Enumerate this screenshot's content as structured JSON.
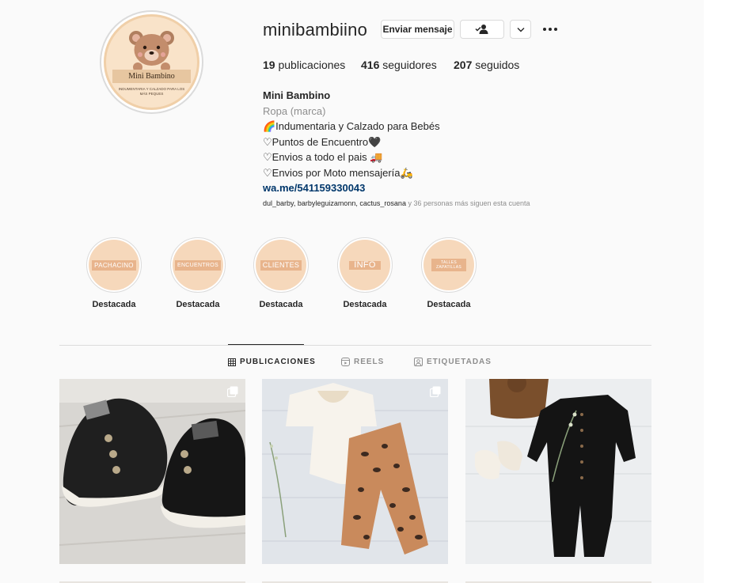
{
  "profile": {
    "avatar_brand": "Mini Bambino",
    "avatar_subtitle": "Indumentaria y calzado para los más peques",
    "username": "minibambiino",
    "message_button": "Enviar mensaje",
    "stats": {
      "posts_count": "19",
      "posts_label": "publicaciones",
      "followers_count": "416",
      "followers_label": "seguidores",
      "following_count": "207",
      "following_label": "seguidos"
    },
    "full_name": "Mini Bambino",
    "category": "Ropa (marca)",
    "bio_lines": [
      "🌈Indumentaria y Calzado para Bebés",
      "♡Puntos de Encuentro🖤",
      "♡Envios a todo el pais 🚚",
      "♡Envios por Moto mensajería🛵"
    ],
    "website": "wa.me/541159330043",
    "followed_by_names": "dul_barby, barbyleguizamonn, cactus_rosana",
    "followed_by_rest": " y 36 personas más siguen esta cuenta"
  },
  "highlights": [
    {
      "cover_text": "PACHACINO",
      "label": "Destacada"
    },
    {
      "cover_text": "ENCUENTROS",
      "label": "Destacada"
    },
    {
      "cover_text": "CLIENTES",
      "label": "Destacada"
    },
    {
      "cover_text": "INFO",
      "label": "Destacada"
    },
    {
      "cover_text": "TALLES ZAPATILLAS",
      "label": "Destacada"
    }
  ],
  "tabs": [
    {
      "label": "PUBLICACIONES",
      "icon": "grid-icon",
      "active": true
    },
    {
      "label": "REELS",
      "icon": "reels-icon",
      "active": false
    },
    {
      "label": "ETIQUETADAS",
      "icon": "tagged-icon",
      "active": false
    }
  ],
  "posts": [
    {
      "subject": "black sneakers",
      "multi": true
    },
    {
      "subject": "bodysuit and leopard pants",
      "multi": true
    },
    {
      "subject": "black romper with knit hat",
      "multi": false
    }
  ],
  "colors": {
    "accent_link": "#00376b",
    "highlight_bg": "#f6d8bb",
    "highlight_tag": "#e8b48c",
    "border": "#dbdbdb"
  }
}
